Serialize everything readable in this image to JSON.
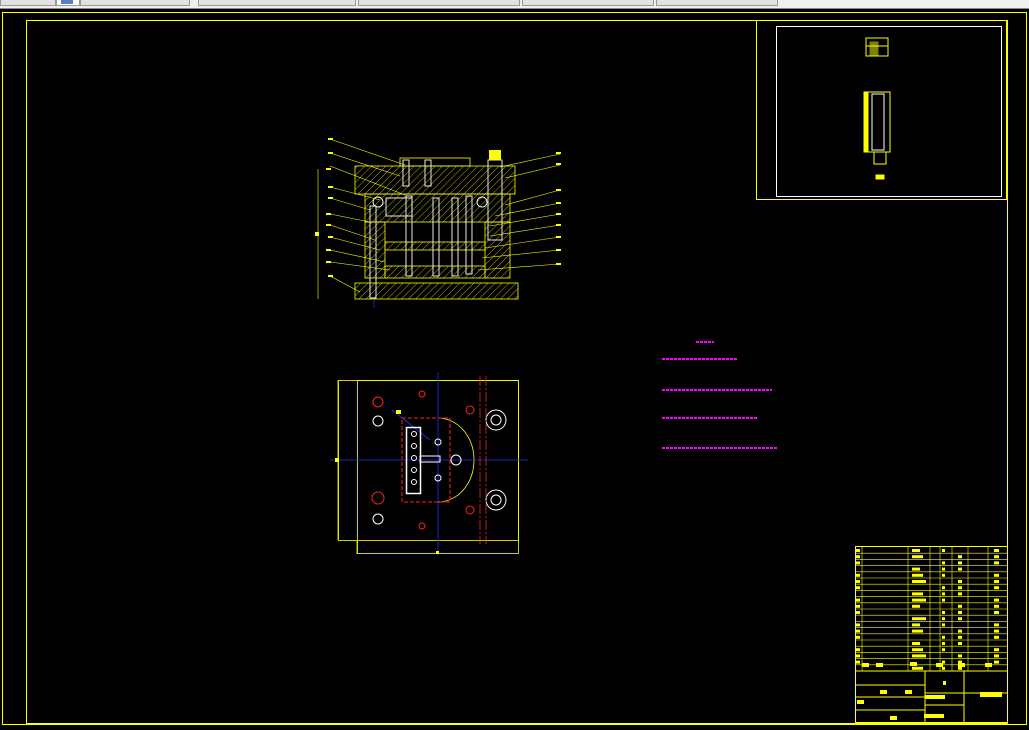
{
  "app": {
    "tabs": [
      {
        "label": ""
      },
      {
        "label": ""
      },
      {
        "label": ""
      },
      {
        "label": ""
      },
      {
        "label": ""
      },
      {
        "label": ""
      }
    ]
  },
  "drawing": {
    "colors": {
      "background": "#000000",
      "frame": "#ffff00",
      "centerline": "#2030ff",
      "hole_red": "#ff2020",
      "notes": "#ff00ff",
      "white": "#ffffff"
    },
    "tech_notes": {
      "title": "",
      "lines": [
        "",
        "",
        "",
        ""
      ]
    },
    "title_block": {
      "drawing_name": "",
      "material": ""
    }
  }
}
